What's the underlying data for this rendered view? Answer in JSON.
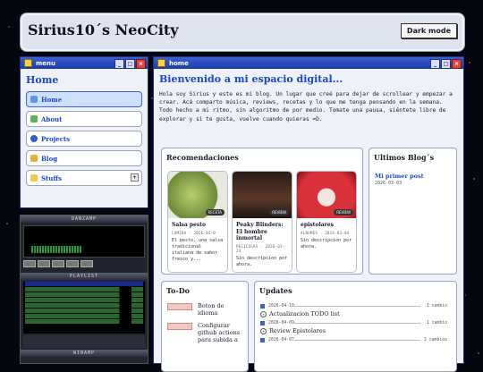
{
  "header": {
    "site_title": "Sirius10´s NeoCity",
    "dark_mode_label": "Dark mode"
  },
  "menu_window": {
    "title": "menu",
    "heading": "Home",
    "items": [
      {
        "label": "Home",
        "icon": "home-icon"
      },
      {
        "label": "About",
        "icon": "people-icon"
      },
      {
        "label": "Projects",
        "icon": "globe-icon"
      },
      {
        "label": "Blog",
        "icon": "pencil-icon"
      },
      {
        "label": "Stuffs",
        "icon": "folder-icon"
      }
    ]
  },
  "winamp": {
    "title": "DANZAMP",
    "playlist_title": "PLAYLIST",
    "bottom_label": "WINAMP"
  },
  "home_window": {
    "title": "home",
    "heading": "Bienvenido a mi espacio digital...",
    "intro": "Hola soy Sirius y este es mi blog. Un lugar que creé para dejar de scrollear y empezar a crear. Acá comparto música, reviews, recetas y lo que me tenga pensando en la semana. Todo hecho a mi ritmo, sin algoritmo de por medio. Tomate una pausa, siéntete libre de explorar y si te gusta, vuelve cuando quieras =D."
  },
  "recommendations": {
    "title": "Recomendaciones",
    "items": [
      {
        "name": "Salsa pesto",
        "meta": "COMIDA · 2026-02-0",
        "desc": "El pesto, una salsa tradicional italiana de sabor fresco y...",
        "badge": "RECETA",
        "color": "#8aa65a"
      },
      {
        "name": "Peaky Blinders: El hombre inmortal",
        "meta": "PELICULAS · 2026-03-24",
        "desc": "Sin descripcion por ahora.",
        "badge": "REVIEW",
        "color": "#3a2a22"
      },
      {
        "name": "epistolares",
        "meta": "ALBUMES · 2026-03-04",
        "desc": "Sin descripcion por ahora.",
        "badge": "REVIEW",
        "color": "#c83a3a"
      }
    ]
  },
  "latest_blogs": {
    "title": "Ultimos Blog´s",
    "items": [
      {
        "title": "Mi primer post",
        "date": "2026-03-03"
      }
    ]
  },
  "todo": {
    "title": "To-Do",
    "items": [
      {
        "text": "Boton de idioma"
      },
      {
        "text": "Configurar github actions para subida a"
      }
    ]
  },
  "updates": {
    "title": "Updates",
    "items": [
      {
        "date": "2026-04-10",
        "count": "1 cambio",
        "name": "Actualizacion TODO list"
      },
      {
        "date": "2026-04-09",
        "count": "1 cambio",
        "name": "Review Epistolares"
      },
      {
        "date": "2026-04-07",
        "count": "2 cambios",
        "name": ""
      }
    ]
  }
}
